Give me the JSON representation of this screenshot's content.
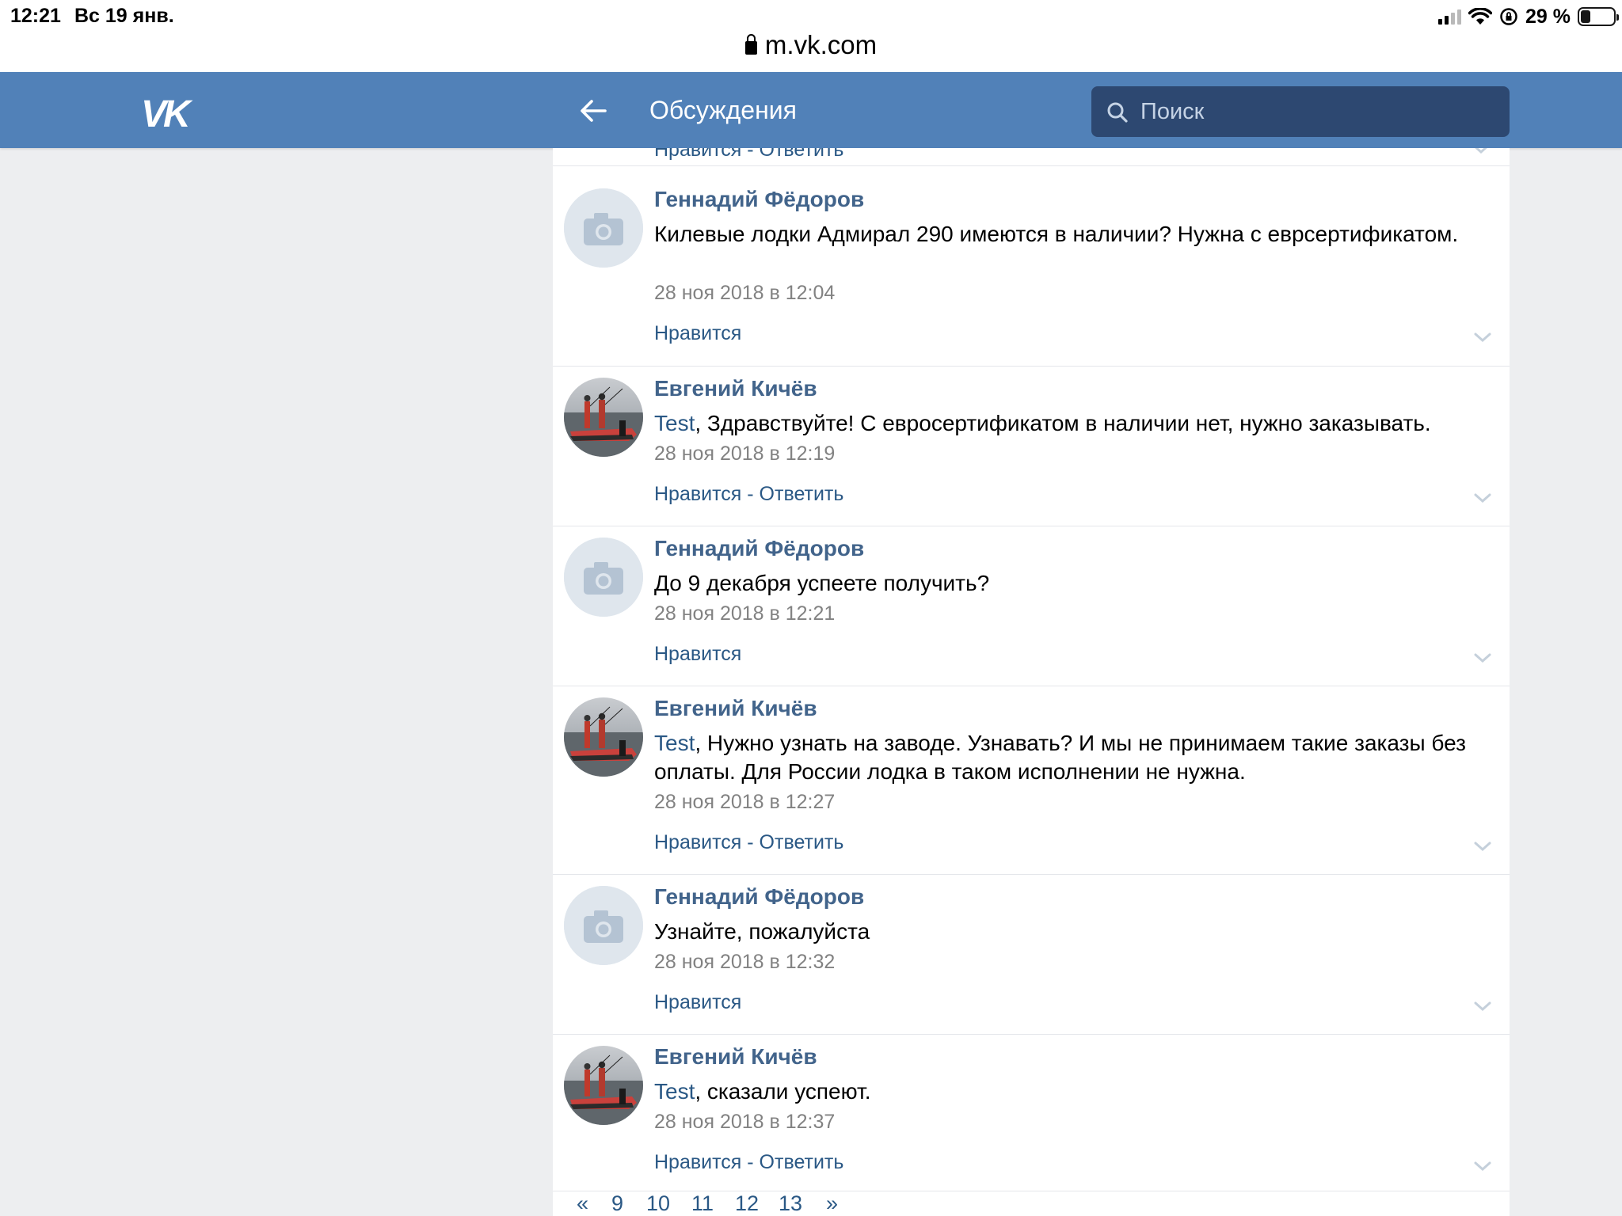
{
  "status_bar": {
    "time": "12:21",
    "date": "Вс 19 янв.",
    "battery": "29 %",
    "battery_level": 0.29
  },
  "browser": {
    "url": "m.vk.com"
  },
  "header": {
    "logo": "VK",
    "title": "Обсуждения",
    "search_placeholder": "Поиск"
  },
  "labels": {
    "like": "Нравится",
    "separator": " - ",
    "reply": "Ответить"
  },
  "previous_actions": "Нравится - Ответить",
  "posts": [
    {
      "author": "Геннадий Фёдоров",
      "mention": "",
      "text": "Килевые лодки Адмирал 290 имеются в наличии? Нужна с еврсертификатом.",
      "date": "28 ноя 2018 в 12:04",
      "reply": false,
      "avatar": "camera-placeholder"
    },
    {
      "author": "Евгений Кичёв",
      "mention": "Test",
      "text": ", Здравствуйте! С евросертификатом в наличии нет, нужно заказывать.",
      "date": "28 ноя 2018 в 12:19",
      "reply": true,
      "avatar": "boat-photo"
    },
    {
      "author": "Геннадий Фёдоров",
      "mention": "",
      "text": "До 9 декабря успеете получить?",
      "date": "28 ноя 2018 в 12:21",
      "reply": false,
      "avatar": "camera-placeholder"
    },
    {
      "author": "Евгений Кичёв",
      "mention": "Test",
      "text": ", Нужно узнать на заводе. Узнавать? И мы не принимаем такие заказы без оплаты. Для России лодка в таком исполнении не нужна.",
      "date": "28 ноя 2018 в 12:27",
      "reply": true,
      "avatar": "boat-photo"
    },
    {
      "author": "Геннадий Фёдоров",
      "mention": "",
      "text": "Узнайте, пожалуйста",
      "date": "28 ноя 2018 в 12:32",
      "reply": false,
      "avatar": "camera-placeholder"
    },
    {
      "author": "Евгений Кичёв",
      "mention": "Test",
      "text": ", сказали успеют.",
      "date": "28 ноя 2018 в 12:37",
      "reply": true,
      "avatar": "boat-photo"
    }
  ],
  "pagination": {
    "prev": "«",
    "pages": [
      "9",
      "10",
      "11",
      "12",
      "13"
    ],
    "next": "»"
  },
  "colors": {
    "header": "#5181b8",
    "search_bg": "#2d4871",
    "author": "#42648b",
    "link": "#2a5885",
    "meta": "#828282",
    "page_bg": "#edeef0"
  }
}
